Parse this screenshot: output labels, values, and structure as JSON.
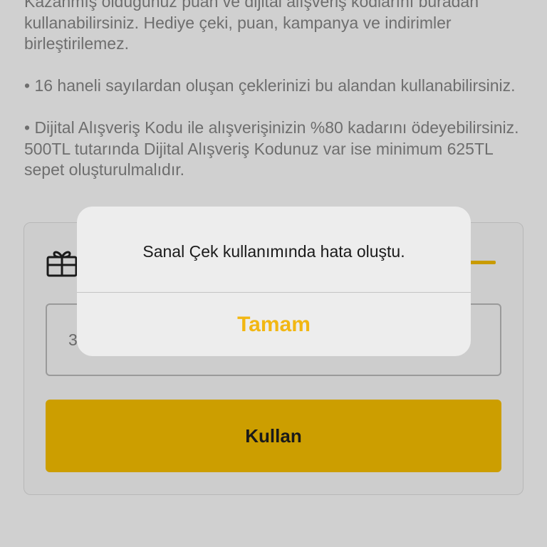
{
  "info": {
    "paragraph1": "Kazanmış olduğunuz puan ve dijital alışveriş kodlarını buradan kullanabilirsiniz. Hediye çeki, puan, kampanya ve indirimler birleştirilemez.",
    "paragraph2": "• 16 haneli sayılardan oluşan çeklerinizi bu alandan kullanabilirsiniz.",
    "paragraph3": "• Dijital Alışveriş Kodu ile alışverişinizin %80 kadarını ödeyebilirsiniz. 500TL tutarında Dijital Alışveriş Kodunuz var ise minimum 625TL sepet oluşturulmalıdır."
  },
  "form": {
    "code_value": "3",
    "use_label": "Kullan"
  },
  "alert": {
    "message": "Sanal Çek kullanımında hata oluştu.",
    "ok_label": "Tamam"
  },
  "colors": {
    "accent": "#cc9e00",
    "alert_button": "#f2b713",
    "background": "#d0d0d0"
  },
  "icons": {
    "card_icon": "gift-card-icon"
  }
}
